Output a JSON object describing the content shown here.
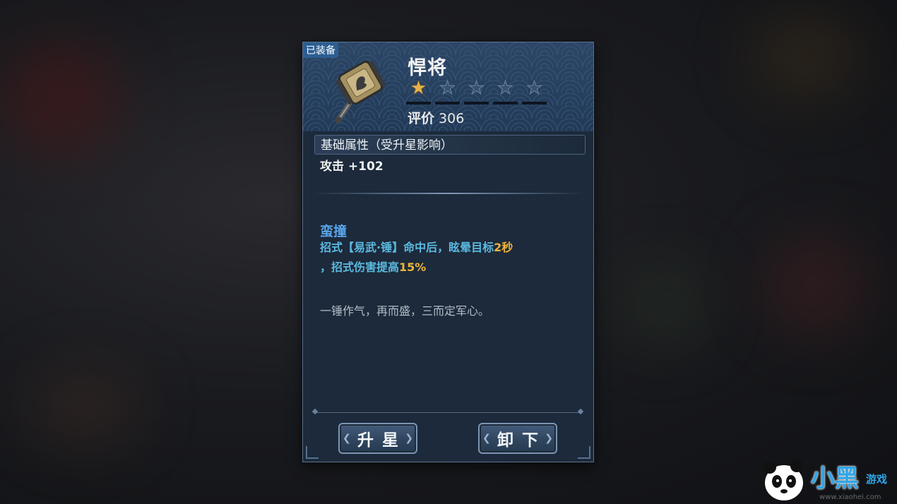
{
  "equipped_tag": "已装备",
  "item": {
    "name": "悍将",
    "stars_total": 5,
    "stars_filled": 1,
    "rating_label": "评价",
    "rating_value": "306"
  },
  "base_attributes": {
    "header": "基础属性（受升星影响）",
    "attack": "攻击 +102"
  },
  "skill": {
    "name": "蛮撞",
    "desc_part1": "招式【易武·锤】命中后，眩晕目标",
    "desc_value1": "2秒",
    "desc_part2": "，招式伤害提高",
    "desc_value2": "15%"
  },
  "flavor_text": "一锤作气，再而盛，三而定军心。",
  "buttons": {
    "star_up": "升星",
    "unequip": "卸下"
  },
  "watermark": {
    "brand": "小黑",
    "sub": "游戏",
    "url": "www.xiaohei.com"
  },
  "colors": {
    "star_on": "#e7b24a",
    "skill_name": "#5aa4e8",
    "skill_desc": "#5cb9e0",
    "highlight": "#f0b43a"
  }
}
